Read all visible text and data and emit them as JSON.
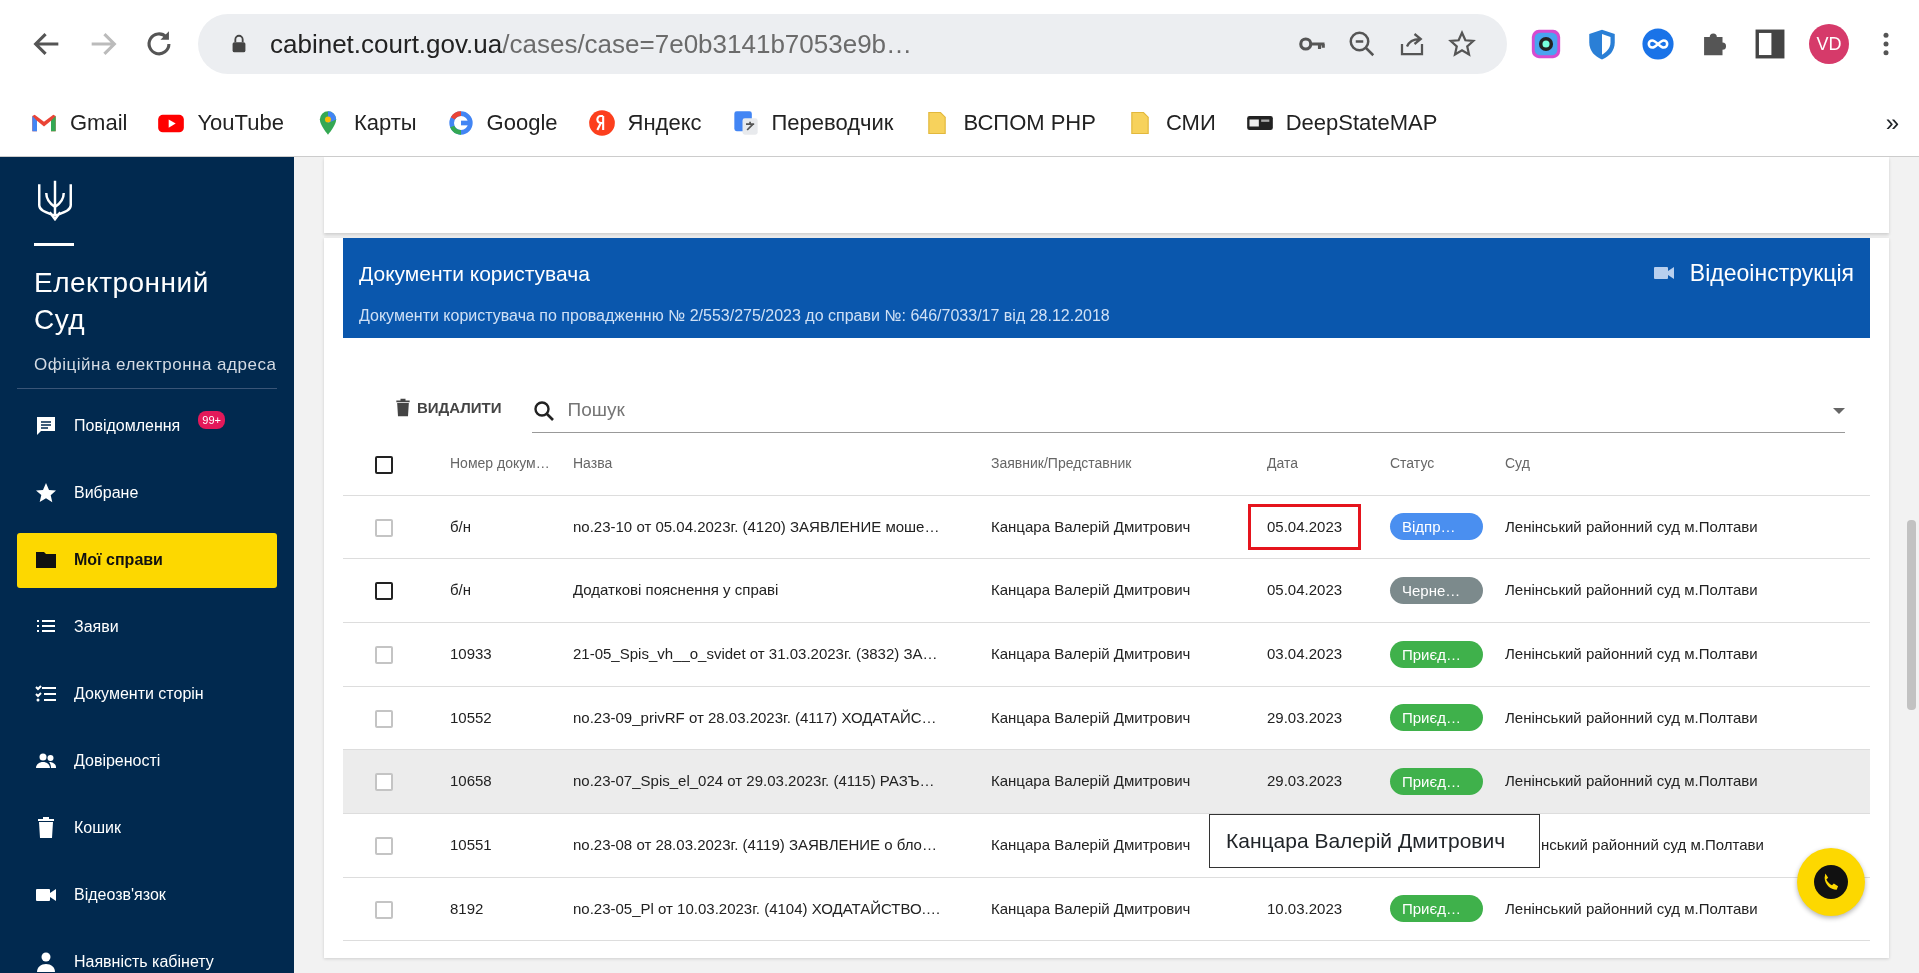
{
  "browser": {
    "url_host": "cabinet.court.gov.ua",
    "url_path": "/cases/case=7e0b3141b7053e9b…",
    "profile": "VD",
    "more": "»",
    "bookmarks": [
      {
        "label": "Gmail",
        "kind": "gmail"
      },
      {
        "label": "YouTube",
        "kind": "youtube"
      },
      {
        "label": "Карты",
        "kind": "maps"
      },
      {
        "label": "Google",
        "kind": "google"
      },
      {
        "label": "Яндекс",
        "kind": "yandex"
      },
      {
        "label": "Переводчик",
        "kind": "translate"
      },
      {
        "label": "ВСПОМ PHP",
        "kind": "folder"
      },
      {
        "label": "СМИ",
        "kind": "folder"
      },
      {
        "label": "DeepStateMAP",
        "kind": "deepstate"
      }
    ]
  },
  "sidebar": {
    "title": "Електронний Суд",
    "subtitle": "Офіційна електронна адреса",
    "items": [
      {
        "label": "Повідомлення",
        "kind": "message",
        "badge": "99+",
        "selected": false
      },
      {
        "label": "Вибране",
        "kind": "star",
        "selected": false
      },
      {
        "label": "Мої справи",
        "kind": "folder",
        "selected": true
      },
      {
        "label": "Заяви",
        "kind": "list",
        "selected": false
      },
      {
        "label": "Документи сторін",
        "kind": "checklist",
        "selected": false
      },
      {
        "label": "Довіреності",
        "kind": "people",
        "selected": false
      },
      {
        "label": "Кошик",
        "kind": "trash",
        "selected": false
      },
      {
        "label": "Відеозв'язок",
        "kind": "video",
        "selected": false
      },
      {
        "label": "Наявність кабінету",
        "kind": "person",
        "selected": false
      }
    ]
  },
  "panel": {
    "title": "Документи користувача",
    "subtitle": "Документи користувача по провадженню № 2/553/275/2023 до справи №: 646/7033/17 від 28.12.2018",
    "video_link": "Відеоінструкція"
  },
  "toolbar": {
    "delete": "ВИДАЛИТИ",
    "search_placeholder": "Пошук"
  },
  "table": {
    "columns": [
      "Номер докум…",
      "Назва",
      "Заявник/Представник",
      "Дата",
      "Статус",
      "Суд"
    ],
    "header_checked": false,
    "rows": [
      {
        "checked": false,
        "checkbox_hovered": false,
        "hovered": false,
        "covered": false,
        "number": "б/н",
        "name": "no.23-10 от 05.04.2023г. (4120) ЗАЯВЛЕНИЕ моше…",
        "applicant": "Канцара Валерій Дмитрович",
        "date": "05.04.2023",
        "date_highlighted": true,
        "status": "Відпр…",
        "color": "#4a8ff0",
        "court": "Ленінський районний суд м.Полтави"
      },
      {
        "checked": false,
        "checkbox_hovered": true,
        "hovered": false,
        "covered": false,
        "number": "б/н",
        "name": "Додаткові пояснення у справі",
        "applicant": "Канцара Валерій Дмитрович",
        "date": "05.04.2023",
        "date_highlighted": false,
        "status": "Черне…",
        "color": "#7c8a8c",
        "court": "Ленінський районний суд м.Полтави"
      },
      {
        "checked": false,
        "checkbox_hovered": false,
        "hovered": false,
        "covered": false,
        "number": "10933",
        "name": "21-05_Spis_vh__o_svidet от 31.03.2023г. (3832) ЗА…",
        "applicant": "Канцара Валерій Дмитрович",
        "date": "03.04.2023",
        "date_highlighted": false,
        "status": "Приєд…",
        "color": "#3fb14b",
        "court": "Ленінський районний суд м.Полтави"
      },
      {
        "checked": false,
        "checkbox_hovered": false,
        "hovered": false,
        "covered": false,
        "number": "10552",
        "name": "no.23-09_privRF от 28.03.2023г. (4117) ХОДАТАЙС…",
        "applicant": "Канцара Валерій Дмитрович",
        "date": "29.03.2023",
        "date_highlighted": false,
        "status": "Приєд…",
        "color": "#3fb14b",
        "court": "Ленінський районний суд м.Полтави"
      },
      {
        "checked": false,
        "checkbox_hovered": false,
        "hovered": true,
        "covered": false,
        "number": "10658",
        "name": "no.23-07_Spis_el_024 от 29.03.2023г. (4115) РАЗЪ…",
        "applicant": "Канцара Валерій Дмитрович",
        "date": "29.03.2023",
        "date_highlighted": false,
        "status": "Приєд…",
        "color": "#3fb14b",
        "court": "Ленінський районний суд м.Полтави"
      },
      {
        "checked": false,
        "checkbox_hovered": false,
        "hovered": false,
        "covered": true,
        "number": "10551",
        "name": "no.23-08 от 28.03.2023г. (4119) ЗАЯВЛЕНИЕ о бло…",
        "applicant": "Канцара Валерій Дмитрович",
        "court": "нський районний суд м.Полтави"
      },
      {
        "checked": false,
        "checkbox_hovered": false,
        "hovered": false,
        "covered": false,
        "number": "8192",
        "name": "no.23-05_Pl от 10.03.2023г. (4104) ХОДАТАЙСТВО.…",
        "applicant": "Канцара Валерій Дмитрович",
        "date": "10.03.2023",
        "date_highlighted": false,
        "status": "Приєд…",
        "color": "#3fb14b",
        "court": "Ленінський районний суд м.Полтави"
      }
    ]
  },
  "tooltip": "Канцара Валерій Дмитрович"
}
